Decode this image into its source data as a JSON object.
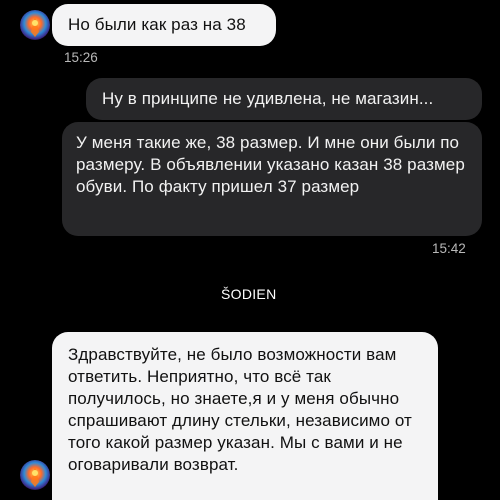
{
  "colors": {
    "background": "#000000",
    "incoming_bubble": "#f4f4f5",
    "outgoing_bubble": "#272729",
    "timestamp": "#b8b8b8"
  },
  "messages": [
    {
      "direction": "incoming",
      "text": "Но были как раз на 38",
      "time": "15:26",
      "has_avatar": true
    },
    {
      "direction": "outgoing",
      "text": "Ну в принципе не удивлена, не магазин..."
    },
    {
      "direction": "outgoing",
      "text": "У меня такие же, 38 размер. И мне они были по размеру. В объявлении указано казан 38 размер обуви. По факту пришел 37 размер",
      "time": "15:42"
    },
    {
      "direction": "incoming",
      "sender": "ŠODIEN",
      "text": "Здравствуйте, не было возможности вам ответить. Неприятно, что всё так получилось, но знаете,я и у меня обычно спрашивают длину стельки, независимо от того какой размер указан. Мы с вами и не оговаривали возврат.",
      "has_avatar": true
    }
  ],
  "icons": {
    "avatar": "avatar-icon"
  }
}
